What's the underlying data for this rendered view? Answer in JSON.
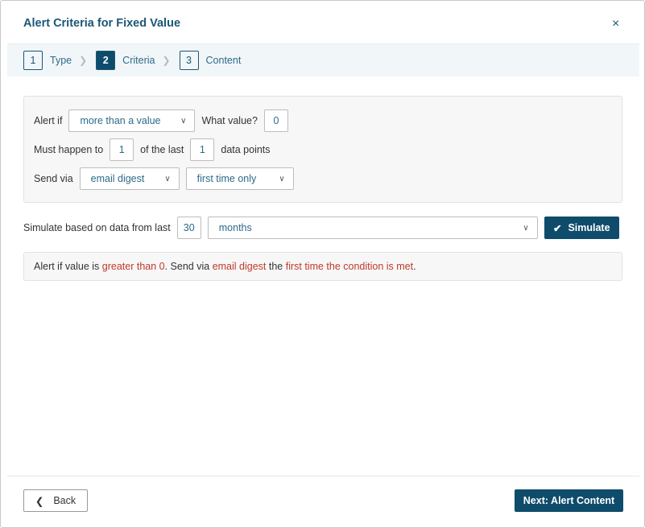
{
  "dialog": {
    "title": "Alert Criteria for Fixed Value",
    "close": "×"
  },
  "steps": [
    {
      "num": "1",
      "label": "Type"
    },
    {
      "num": "2",
      "label": "Criteria"
    },
    {
      "num": "3",
      "label": "Content"
    }
  ],
  "criteria": {
    "alert_if_label": "Alert if",
    "alert_if_value": "more than a value",
    "what_value_label": "What value?",
    "what_value": "0",
    "must_happen_label": "Must happen to",
    "must_happen_value": "1",
    "of_last_label": "of the last",
    "of_last_value": "1",
    "data_points_label": "data points",
    "send_via_label": "Send via",
    "send_via_value": "email digest",
    "frequency_value": "first time only"
  },
  "simulate": {
    "label": "Simulate based on data from last",
    "count": "30",
    "unit": "months",
    "button": "Simulate"
  },
  "summary": {
    "p1": "Alert if value is ",
    "r1": "greater than 0",
    "p2": ". Send via ",
    "r2": "email digest",
    "p3": " the ",
    "r3": "first time the condition is met",
    "p4": "."
  },
  "footer": {
    "back": "Back",
    "next": "Next: Alert Content"
  },
  "colors": {
    "primary": "#0f4c6b",
    "accent_text": "#c0392b"
  }
}
